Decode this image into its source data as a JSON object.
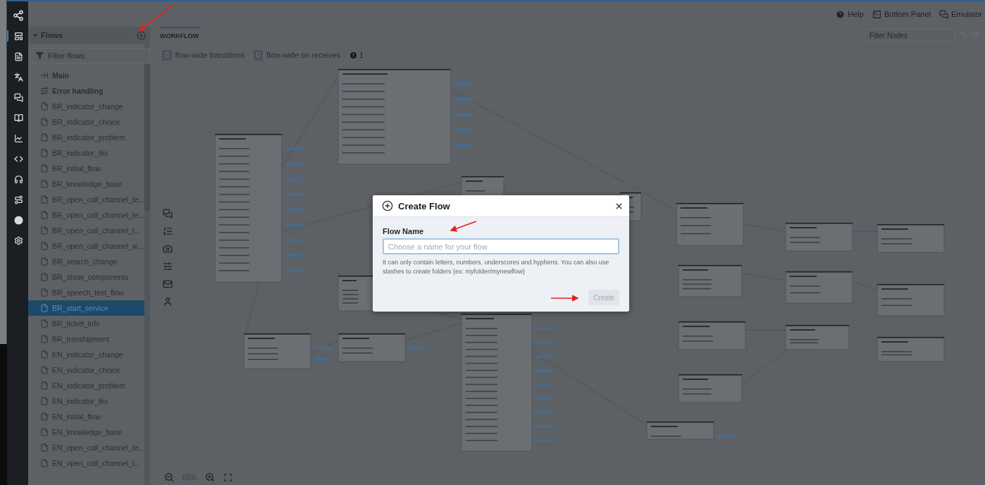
{
  "header_links": [
    {
      "label": "Help",
      "kind": "help"
    },
    {
      "label": "Bottom Panel",
      "kind": "panel"
    },
    {
      "label": "Emulator",
      "kind": "emulator"
    }
  ],
  "sidebar": {
    "title": "Flows",
    "expanded": true,
    "filter_placeholder": "Filter flows",
    "items": [
      {
        "label": "Main",
        "kind": "main",
        "selected": false
      },
      {
        "label": "Error handling",
        "kind": "error",
        "selected": false
      },
      {
        "label": "BR_indicator_change",
        "kind": "file",
        "selected": false
      },
      {
        "label": "BR_indicator_choice",
        "kind": "file",
        "selected": false
      },
      {
        "label": "BR_indicator_problem",
        "kind": "file",
        "selected": false
      },
      {
        "label": "BR_indicator_tks",
        "kind": "file",
        "selected": false
      },
      {
        "label": "BR_initial_flow",
        "kind": "file",
        "selected": false
      },
      {
        "label": "BR_knowledge_base",
        "kind": "file",
        "selected": false
      },
      {
        "label": "BR_open_call_channel_te...",
        "kind": "file",
        "selected": false
      },
      {
        "label": "BR_open_call_channel_te...",
        "kind": "file",
        "selected": false
      },
      {
        "label": "BR_open_call_channel_t...",
        "kind": "file",
        "selected": false
      },
      {
        "label": "BR_open_call_channel_w...",
        "kind": "file",
        "selected": false
      },
      {
        "label": "BR_search_change",
        "kind": "file",
        "selected": false
      },
      {
        "label": "BR_show_components",
        "kind": "file",
        "selected": false
      },
      {
        "label": "BR_speech_test_flow",
        "kind": "file",
        "selected": false
      },
      {
        "label": "BR_start_service",
        "kind": "file",
        "selected": true
      },
      {
        "label": "BR_ticket_info",
        "kind": "file",
        "selected": false
      },
      {
        "label": "BR_transhipment",
        "kind": "file",
        "selected": false
      },
      {
        "label": "EN_indicator_change",
        "kind": "file",
        "selected": false
      },
      {
        "label": "EN_indicator_choice",
        "kind": "file",
        "selected": false
      },
      {
        "label": "EN_indicator_problem",
        "kind": "file",
        "selected": false
      },
      {
        "label": "EN_indicator_tks",
        "kind": "file",
        "selected": false
      },
      {
        "label": "EN_initial_flow",
        "kind": "file",
        "selected": false
      },
      {
        "label": "EN_knowledge_base",
        "kind": "file",
        "selected": false
      },
      {
        "label": "EN_open_call_channel_te...",
        "kind": "file",
        "selected": false
      },
      {
        "label": "EN_open_call_channel_t...",
        "kind": "file",
        "selected": false
      }
    ]
  },
  "workflow": {
    "tab": "WORKFLOW",
    "transitions_count": "0",
    "transitions_label": "flow-wide transitions",
    "receives_count": "0",
    "receives_label": "flow-wide on receives",
    "warnings": "1",
    "filter_placeholder": "Filter Nodes",
    "zoom": "65%"
  },
  "dialog": {
    "title": "Create Flow",
    "field_label": "Flow Name",
    "placeholder": "Choose a name for your flow",
    "hint": "It can only contain letters, numbers, underscores and hyphens. You can also use slashes to create folders (ex: myfolder/mynewflow)",
    "button": "Create",
    "button_disabled": true
  }
}
